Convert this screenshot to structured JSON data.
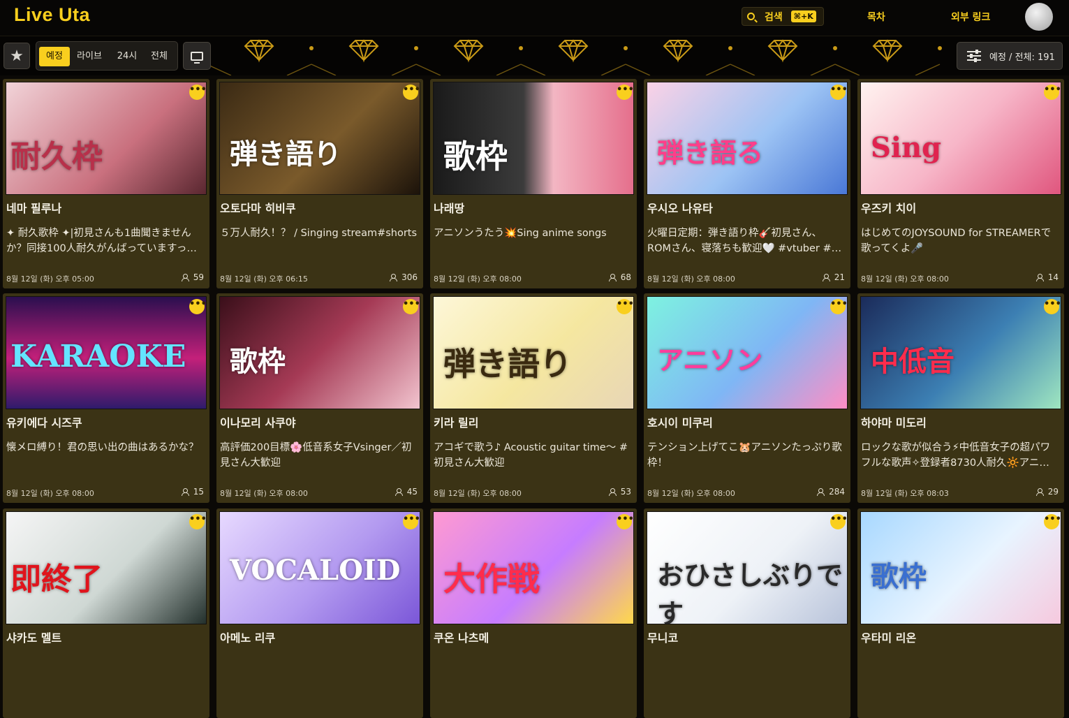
{
  "header": {
    "logo": "Live Uta",
    "search_label": "검색",
    "search_shortcut": "⌘+K",
    "nav": [
      {
        "label": "목차"
      },
      {
        "label": "외부 링크"
      }
    ]
  },
  "filters": {
    "tabs": [
      {
        "label": "예정",
        "active": true
      },
      {
        "label": "라이브",
        "active": false
      },
      {
        "label": "24시",
        "active": false
      },
      {
        "label": "전체",
        "active": false
      }
    ],
    "count_label": "예정 / 전체: 191"
  },
  "colors": {
    "accent": "#f9cf1e",
    "card_bg": "#3b3315",
    "page_bg": "#0b0906"
  },
  "cards": [
    {
      "name": "네마 필루나",
      "title": "✦ 耐久歌枠 ✦|初見さんも1曲聞きませんか？同接100人耐久がんばっていますっ…",
      "date": "8월 12일 (화) 오후 05:00",
      "viewers": "59",
      "thumb_text": "耐久枠",
      "thumb_bg": "linear-gradient(135deg,#f1d3d8,#c9707e 60%,#5a2730)",
      "thumb_color": "#b8304a"
    },
    {
      "name": "오토다마 히비쿠",
      "title": "５万人耐久！？ / Singing stream#shorts",
      "date": "8월 12일 (화) 오후 06:15",
      "viewers": "306",
      "thumb_text": "弾き語り",
      "thumb_bg": "linear-gradient(135deg,#3b2a14,#7a5a2b 55%,#1c130a)",
      "thumb_color": "#ffffff"
    },
    {
      "name": "나래땅",
      "title": "アニソンうたう💥Sing anime songs",
      "date": "8월 12일 (화) 오후 08:00",
      "viewers": "68",
      "thumb_text": "歌枠",
      "thumb_bg": "linear-gradient(90deg,#1a1a1a,#3b3b3b 45%,#f3b6c3 60%,#e56f8c)",
      "thumb_color": "#ffffff"
    },
    {
      "name": "우시오 나유타",
      "title": "火曜日定期：弾き語り枠🎸初見さん、ROMさん、寝落ちも歓迎🤍 #vtuber #…",
      "date": "8월 12일 (화) 오후 08:00",
      "viewers": "21",
      "thumb_text": "弾き語る",
      "thumb_bg": "linear-gradient(135deg,#fbd2e6,#9cc3f4 55%,#4a78d6)",
      "thumb_color": "#ff3e8a"
    },
    {
      "name": "우즈키 치이",
      "title": "はじめてのJOYSOUND for STREAMERで歌ってくよ🎤",
      "date": "8월 12일 (화) 오후 08:00",
      "viewers": "14",
      "thumb_text": "Sing",
      "thumb_bg": "linear-gradient(135deg,#fff3f0,#f7b6c8 50%,#e0567e)",
      "thumb_color": "#e0234f"
    },
    {
      "name": "유키에다 시즈쿠",
      "title": "懐メロ縛り！君の思い出の曲はあるかな？",
      "date": "8월 12일 (화) 오후 08:00",
      "viewers": "15",
      "thumb_text": "KARAOKE",
      "thumb_bg": "linear-gradient(180deg,#2a0f4f,#c4207a 55%,#2e1b6b)",
      "thumb_color": "#64e4ff"
    },
    {
      "name": "이나모리 사쿠야",
      "title": "高評価200目標🌸低音系女子Vsinger／初見さん大歓迎",
      "date": "8월 12일 (화) 오후 08:00",
      "viewers": "45",
      "thumb_text": "歌枠",
      "thumb_bg": "linear-gradient(135deg,#3a0f1a,#a53a55 50%,#f2c4cf)",
      "thumb_color": "#ffffff"
    },
    {
      "name": "키라 릴리",
      "title": "アコギで歌う♪ Acoustic guitar time～ #初見さん大歓迎",
      "date": "8월 12일 (화) 오후 08:00",
      "viewers": "53",
      "thumb_text": "弾き語り",
      "thumb_bg": "linear-gradient(135deg,#fdf7d8,#f5e7a0 55%,#e8d6b6)",
      "thumb_color": "#3a2a10"
    },
    {
      "name": "호시이 미쿠리",
      "title": "テンション上げてこ🐹アニソンたっぷり歌枠！",
      "date": "8월 12일 (화) 오후 08:00",
      "viewers": "284",
      "thumb_text": "アニソン",
      "thumb_bg": "linear-gradient(135deg,#7ef2e0,#7fb6f5 55%,#ff8ec4)",
      "thumb_color": "#ff3c9c"
    },
    {
      "name": "하야마 미도리",
      "title": "ロックな歌が似合う⚡中低音女子の超パワフルな歌声✧登録者8730人耐久🔆アニ…",
      "date": "8월 12일 (화) 오후 08:03",
      "viewers": "29",
      "thumb_text": "中低音",
      "thumb_bg": "linear-gradient(135deg,#1b2b5a,#3c7fb3 55%,#9fe6c0)",
      "thumb_color": "#ff2c4c"
    },
    {
      "name": "샤카도 멜트",
      "title": "",
      "date": "",
      "viewers": "",
      "thumb_text": "即終了",
      "thumb_bg": "linear-gradient(135deg,#f5f5f5,#cfd8d4 55%,#23302c)",
      "thumb_color": "#e0141c"
    },
    {
      "name": "아메노 리쿠",
      "title": "",
      "date": "",
      "viewers": "",
      "thumb_text": "VOCALOID",
      "thumb_bg": "linear-gradient(135deg,#e7d9ff,#b39af0 55%,#7b57d8)",
      "thumb_color": "#ffffff"
    },
    {
      "name": "쿠온 나츠메",
      "title": "",
      "date": "",
      "viewers": "",
      "thumb_text": "大作戦",
      "thumb_bg": "linear-gradient(135deg,#ff9ad1,#c67cff 55%,#ffd84a)",
      "thumb_color": "#ff2c4c"
    },
    {
      "name": "무니코",
      "title": "",
      "date": "",
      "viewers": "",
      "thumb_text": "おひさしぶりです",
      "thumb_bg": "linear-gradient(135deg,#ffffff,#eef2f7 55%,#b8c3da)",
      "thumb_color": "#2a2a2a"
    },
    {
      "name": "우타미 리온",
      "title": "",
      "date": "",
      "viewers": "",
      "thumb_text": "歌枠",
      "thumb_bg": "linear-gradient(135deg,#a8d8ff,#e8f4ff 55%,#f6c9de)",
      "thumb_color": "#3a6fd0"
    }
  ]
}
